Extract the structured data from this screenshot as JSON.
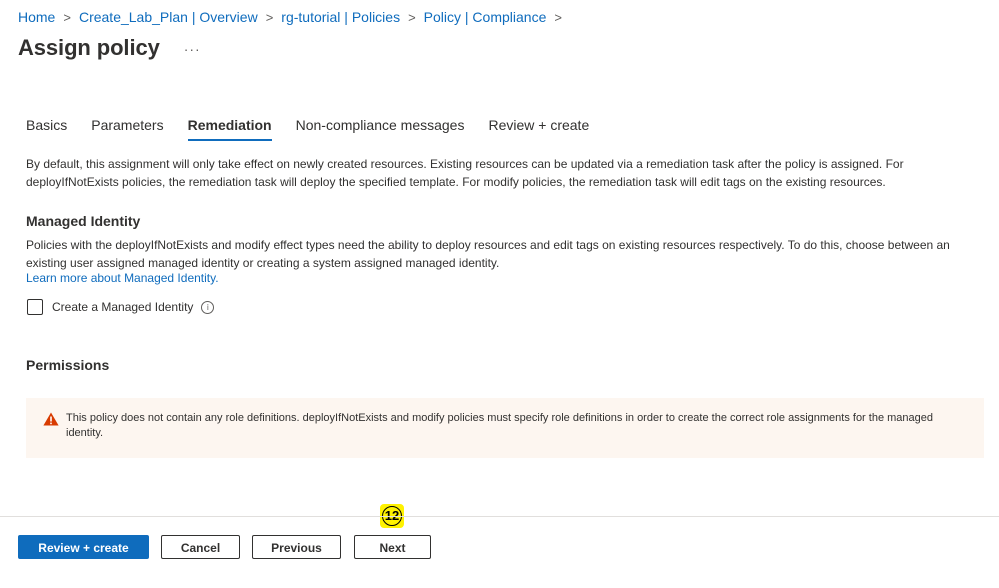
{
  "breadcrumb": {
    "items": [
      "Home",
      "Create_Lab_Plan | Overview",
      "rg-tutorial | Policies",
      "Policy | Compliance"
    ],
    "separator": ">"
  },
  "page": {
    "title": "Assign policy",
    "more_label": "···"
  },
  "tabs": [
    {
      "label": "Basics",
      "active": false
    },
    {
      "label": "Parameters",
      "active": false
    },
    {
      "label": "Remediation",
      "active": true
    },
    {
      "label": "Non-compliance messages",
      "active": false
    },
    {
      "label": "Review + create",
      "active": false
    }
  ],
  "remediation": {
    "intro": "By default, this assignment will only take effect on newly created resources. Existing resources can be updated via a remediation task after the policy is assigned. For deployIfNotExists policies, the remediation task will deploy the specified template. For modify policies, the remediation task will edit tags on the existing resources."
  },
  "managed_identity": {
    "heading": "Managed Identity",
    "description": "Policies with the deployIfNotExists and modify effect types need the ability to deploy resources and edit tags on existing resources respectively. To do this, choose between an existing user assigned managed identity or creating a system assigned managed identity.",
    "learn_more": "Learn more about Managed Identity.",
    "checkbox_label": "Create a Managed Identity",
    "checked": false,
    "info_glyph": "i"
  },
  "permissions": {
    "heading": "Permissions",
    "warning": "This policy does not contain any role definitions. deployIfNotExists and modify policies must specify role definitions in order to create the correct role assignments for the managed identity.",
    "warning_icon": "warning-triangle-icon",
    "warning_color": "#d83b01"
  },
  "footer": {
    "review_create": "Review + create",
    "cancel": "Cancel",
    "previous": "Previous",
    "next": "Next"
  },
  "step_badge": "12",
  "colors": {
    "accent": "#0f6cbd",
    "warning_bg": "#fdf6f0",
    "badge": "#fff200"
  }
}
